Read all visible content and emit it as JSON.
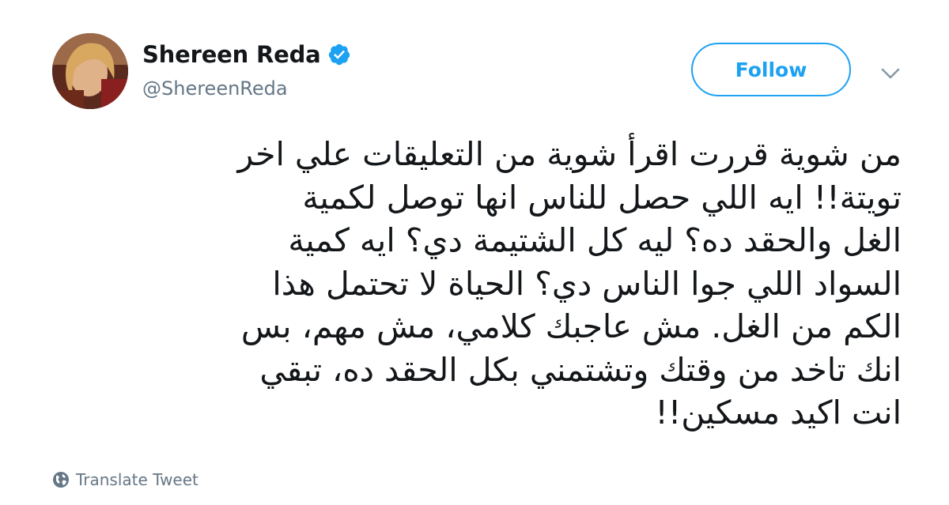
{
  "user": {
    "display_name": "Shereen Reda",
    "handle": "@ShereenReda",
    "verified": true
  },
  "actions": {
    "follow_label": "Follow"
  },
  "tweet": {
    "lines": [
      "من شوية قررت اقرأ شوية من التعليقات علي اخر",
      "تويتة!! ايه اللي حصل للناس انها توصل لكمية",
      "الغل والحقد ده؟ ليه كل الشتيمة دي؟ ايه كمية",
      "السواد اللي جوا الناس دي؟ الحياة لا تحتمل هذا",
      "الكم من الغل. مش عاجبك كلامي، مش مهم، بس",
      "انك تاخد من وقتك وتشتمني بكل الحقد ده، تبقي",
      "انت اكيد مسكين!!"
    ]
  },
  "footer": {
    "translate_label": "Translate Tweet"
  },
  "icons": {
    "verified": "verified-badge-icon",
    "caret": "chevron-down-icon",
    "translate": "globe-icon"
  },
  "colors": {
    "accent": "#1da1f2",
    "text": "#14171a",
    "secondary": "#657786"
  }
}
